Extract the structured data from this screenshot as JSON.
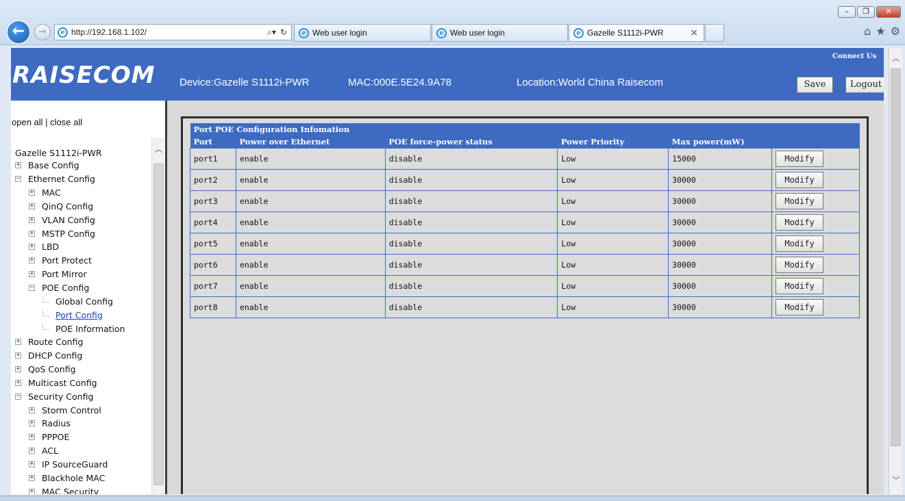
{
  "browser": {
    "window_controls": [
      "–",
      "❐",
      "✕"
    ],
    "back_glyph": "←",
    "forward_glyph": "→",
    "address": "http://192.168.1.102/",
    "address_tools": [
      "⌕▾",
      "↻"
    ],
    "ie_glyph": "e",
    "tabs": [
      {
        "label": "Web user login"
      },
      {
        "label": "Web user login"
      },
      {
        "label": "Gazelle S1112i-PWR",
        "close": "×"
      }
    ],
    "command_icons": [
      "⌂",
      "★",
      "⚙"
    ]
  },
  "header": {
    "logo": "RAISECOM",
    "device": "Device:Gazelle S1112i-PWR",
    "mac": "MAC:000E.5E24.9A78",
    "location": "Location:World China Raisecom",
    "connect_us": "Connect Us",
    "save_label": "Save",
    "logout_label": "Logout"
  },
  "sidebar": {
    "open_close": "open all | close all",
    "root": "Gazelle S1112i-PWR",
    "items": [
      {
        "label": "Base Config",
        "level": 0,
        "box": "+"
      },
      {
        "label": "Ethernet Config",
        "level": 0,
        "box": "−"
      },
      {
        "label": "MAC",
        "level": 1,
        "box": "+"
      },
      {
        "label": "QinQ Config",
        "level": 1,
        "box": "+"
      },
      {
        "label": "VLAN Config",
        "level": 1,
        "box": "+"
      },
      {
        "label": "MSTP Config",
        "level": 1,
        "box": "+"
      },
      {
        "label": "LBD",
        "level": 1,
        "box": "+"
      },
      {
        "label": "Port Protect",
        "level": 1,
        "box": "+"
      },
      {
        "label": "Port Mirror",
        "level": 1,
        "box": "+"
      },
      {
        "label": "POE Config",
        "level": 1,
        "box": "−"
      },
      {
        "label": "Global Config",
        "level": 2,
        "box": ""
      },
      {
        "label": "Port Config",
        "level": 2,
        "box": "",
        "selected": true
      },
      {
        "label": "POE Information",
        "level": 2,
        "box": ""
      },
      {
        "label": "Route Config",
        "level": 0,
        "box": "+"
      },
      {
        "label": "DHCP Config",
        "level": 0,
        "box": "+"
      },
      {
        "label": "QoS Config",
        "level": 0,
        "box": "+"
      },
      {
        "label": "Multicast Config",
        "level": 0,
        "box": "+"
      },
      {
        "label": "Security Config",
        "level": 0,
        "box": "−"
      },
      {
        "label": "Storm Control",
        "level": 1,
        "box": "+"
      },
      {
        "label": "Radius",
        "level": 1,
        "box": "+"
      },
      {
        "label": "PPPOE",
        "level": 1,
        "box": "+"
      },
      {
        "label": "ACL",
        "level": 1,
        "box": "+"
      },
      {
        "label": "IP SourceGuard",
        "level": 1,
        "box": "+"
      },
      {
        "label": "Blackhole MAC",
        "level": 1,
        "box": "+"
      },
      {
        "label": "MAC Security",
        "level": 1,
        "box": "+"
      }
    ],
    "scroll_up": "︿"
  },
  "poe_table": {
    "title": "Port POE Configuration Infomation",
    "columns": [
      "Port",
      "Power over Ethernet",
      "POE force-power status",
      "Power Priority",
      "Max power(mW)",
      ""
    ],
    "modify_label": "Modify",
    "rows": [
      [
        "port1",
        "enable",
        "disable",
        "Low",
        "15000"
      ],
      [
        "port2",
        "enable",
        "disable",
        "Low",
        "30000"
      ],
      [
        "port3",
        "enable",
        "disable",
        "Low",
        "30000"
      ],
      [
        "port4",
        "enable",
        "disable",
        "Low",
        "30000"
      ],
      [
        "port5",
        "enable",
        "disable",
        "Low",
        "30000"
      ],
      [
        "port6",
        "enable",
        "disable",
        "Low",
        "30000"
      ],
      [
        "port7",
        "enable",
        "disable",
        "Low",
        "30000"
      ],
      [
        "port8",
        "enable",
        "disable",
        "Low",
        "30000"
      ]
    ]
  },
  "scrollbar": {
    "up": "︿",
    "down": "﹀"
  },
  "colors": {
    "header_blue": "#3e6bc1",
    "link_blue": "#1a3fb5"
  }
}
